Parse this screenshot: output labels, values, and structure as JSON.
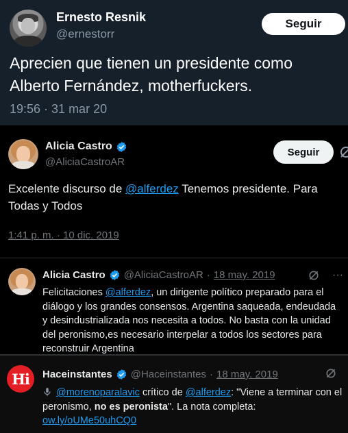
{
  "tweet1": {
    "name": "Ernesto Resnik",
    "handle": "@ernestorr",
    "follow_label": "Seguir",
    "text": "Aprecien que tienen un presidente como Alberto Fernández, motherfuckers.",
    "timestamp": "19:56 · 31 mar 20",
    "avatar_icon": "user-avatar-icon"
  },
  "tweet2": {
    "name": "Alicia Castro",
    "handle": "@AliciaCastroAR",
    "follow_label": "Seguir",
    "text_before": "Excelente discurso de ",
    "mention": "@alferdez",
    "text_after": " Tenemos presidente. Para Todas y Todos",
    "timestamp": "1:41 p. m. · 10 dic. 2019",
    "verified_color": "#1d9bf0"
  },
  "quote1": {
    "name": "Alicia Castro",
    "handle": "@AliciaCastroAR",
    "separator": "·",
    "date": "18 may. 2019",
    "more": "···",
    "text_before": "Felicitaciones ",
    "mention": "@alferdez",
    "text_after": ", un dirigente político preparado para el diálogo y los grandes consensos. Argentina saqueada, endeudada y desindustrializada nos necesita a todos. No basta con la unidad del peronismo,es necesario interpelar a todos los sectores para reconstruir Argentina"
  },
  "quote2": {
    "name": "Haceinstantes",
    "handle": "@Haceinstantes",
    "separator": "·",
    "date": "18 may. 2019",
    "logo_text": "Hi",
    "mic_icon": "microphone-icon",
    "mention1": "@morenoparalavic",
    "text_mid": " crítico de ",
    "mention2": "@alferdez",
    "text_quote": ": \"Viene a terminar con el peronismo, ",
    "text_bold": "no es peronista",
    "text_end": "\". La nota completa: ",
    "link": "ow.ly/oUMe50uhCQ0"
  },
  "colors": {
    "panel1_bg": "#15202b",
    "panel2_bg": "#000000",
    "accent": "#1d9bf0",
    "muted": "#71767b"
  }
}
